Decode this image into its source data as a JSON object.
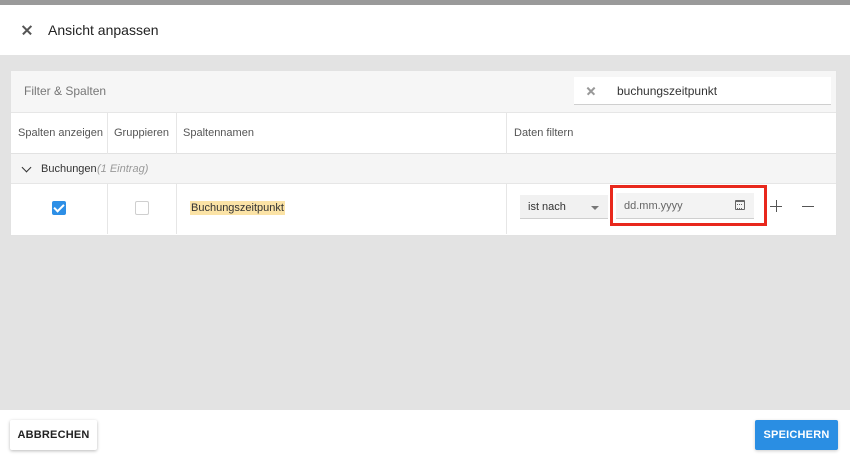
{
  "dialog": {
    "title": "Ansicht anpassen"
  },
  "panel": {
    "label": "Filter & Spalten",
    "search": {
      "value": "buchungszeitpunkt"
    }
  },
  "columns": {
    "show": "Spalten anzeigen",
    "group": "Gruppieren",
    "name": "Spaltennamen",
    "filter": "Daten filtern"
  },
  "group_row": {
    "name": "Buchungen",
    "count": "(1 Eintrag)"
  },
  "row": {
    "show_checked": true,
    "group_checked": false,
    "column_name": "Buchungszeitpunkt",
    "operator": "ist nach",
    "date_placeholder": "dd.mm.yyyy"
  },
  "footer": {
    "cancel": "ABBRECHEN",
    "save": "SPEICHERN"
  },
  "colors": {
    "primary": "#2a8ee3",
    "highlight": "#e8281c",
    "match": "#fbe3a6"
  }
}
